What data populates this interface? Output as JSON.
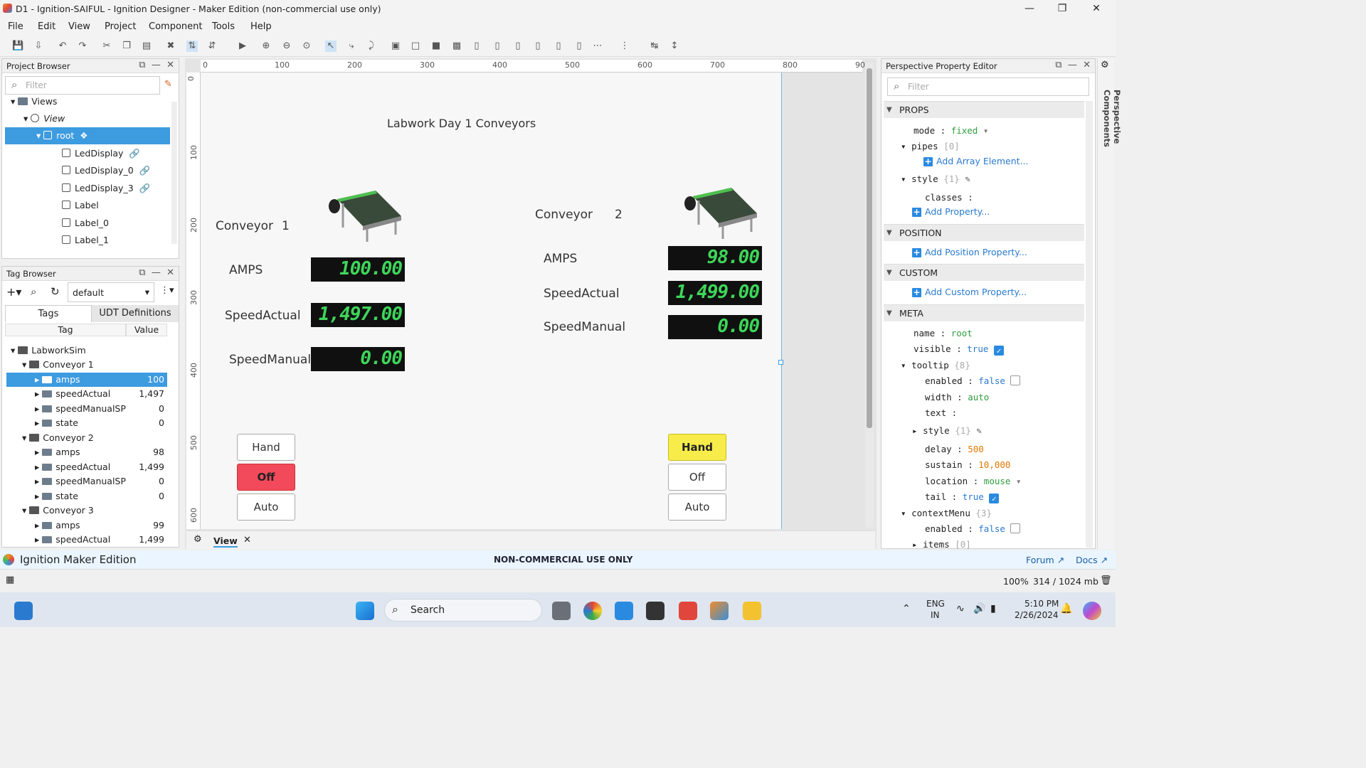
{
  "window": {
    "title": "D1 - Ignition-SAIFUL - Ignition Designer - Maker Edition (non-commercial use only)"
  },
  "menu": [
    "File",
    "Edit",
    "View",
    "Project",
    "Component",
    "Tools",
    "Help"
  ],
  "project_browser": {
    "title": "Project Browser",
    "filter_placeholder": "Filter",
    "items": [
      {
        "label": "Views"
      },
      {
        "label": "View"
      },
      {
        "label": "root"
      },
      {
        "label": "LedDisplay"
      },
      {
        "label": "LedDisplay_0"
      },
      {
        "label": "LedDisplay_3"
      },
      {
        "label": "Label"
      },
      {
        "label": "Label_0"
      },
      {
        "label": "Label_1"
      }
    ]
  },
  "tag_browser": {
    "title": "Tag Browser",
    "provider": "default",
    "tabs": [
      "Tags",
      "UDT Definitions"
    ],
    "col_tag": "Tag",
    "col_value": "Value",
    "rows": [
      {
        "name": "LabworkSim",
        "value": ""
      },
      {
        "name": "Conveyor 1",
        "value": ""
      },
      {
        "name": "amps",
        "value": "100"
      },
      {
        "name": "speedActual",
        "value": "1,497"
      },
      {
        "name": "speedManualSP",
        "value": "0"
      },
      {
        "name": "state",
        "value": "0"
      },
      {
        "name": "Conveyor 2",
        "value": ""
      },
      {
        "name": "amps",
        "value": "98"
      },
      {
        "name": "speedActual",
        "value": "1,499"
      },
      {
        "name": "speedManualSP",
        "value": "0"
      },
      {
        "name": "state",
        "value": "0"
      },
      {
        "name": "Conveyor 3",
        "value": ""
      },
      {
        "name": "amps",
        "value": "99"
      },
      {
        "name": "speedActual",
        "value": "1,499"
      }
    ]
  },
  "ruler": {
    "h": [
      "0",
      "100",
      "200",
      "300",
      "400",
      "500",
      "600",
      "700",
      "800",
      "90"
    ],
    "v": [
      "0",
      "100",
      "200",
      "300",
      "400",
      "500",
      "600"
    ]
  },
  "view": {
    "title": "Labwork Day 1 Conveyors",
    "tab": "View",
    "c1": {
      "name": "Conveyor",
      "num": "1",
      "amps_label": "AMPS",
      "amps": "100.00",
      "sa_label": "SpeedActual",
      "sa": "1,497.00",
      "sm_label": "SpeedManual",
      "sm": "0.00",
      "hand": "Hand",
      "off": "Off",
      "auto": "Auto"
    },
    "c2": {
      "name": "Conveyor",
      "num": "2",
      "amps_label": "AMPS",
      "amps": "98.00",
      "sa_label": "SpeedActual",
      "sa": "1,499.00",
      "sm_label": "SpeedManual",
      "sm": "0.00",
      "hand": "Hand",
      "off": "Off",
      "auto": "Auto"
    },
    "colors": {
      "off_active": "#f24a5a",
      "hand_active": "#f7ec4a",
      "led_text": "#3ed65a"
    }
  },
  "prop_editor": {
    "title": "Perspective Property Editor",
    "filter_placeholder": "Filter",
    "side_tab": "Perspective Components",
    "sections": {
      "props": "PROPS",
      "position": "POSITION",
      "custom": "CUSTOM",
      "meta": "META"
    },
    "props": {
      "mode_k": "mode",
      "mode_v": "fixed",
      "pipes_k": "pipes",
      "pipes_c": "[0]",
      "add_array": "Add Array Element...",
      "style_k": "style",
      "style_c": "{1}",
      "classes_k": "classes",
      "add_prop": "Add Property..."
    },
    "add_position": "Add Position Property...",
    "add_custom": "Add Custom Property...",
    "meta": {
      "name_k": "name",
      "name_v": "root",
      "visible_k": "visible",
      "visible_v": "true",
      "tooltip_k": "tooltip",
      "tooltip_c": "{8}",
      "enabled_k": "enabled",
      "enabled_v": "false",
      "width_k": "width",
      "width_v": "auto",
      "text_k": "text",
      "style_k": "style",
      "style_c": "{1}",
      "delay_k": "delay",
      "delay_v": "500",
      "sustain_k": "sustain",
      "sustain_v": "10,000",
      "location_k": "location",
      "location_v": "mouse",
      "tail_k": "tail",
      "tail_v": "true",
      "ctx_k": "contextMenu",
      "ctx_c": "{3}",
      "ctx_enabled_k": "enabled",
      "ctx_enabled_v": "false",
      "items_k": "items",
      "items_c": "[0]"
    }
  },
  "status": {
    "brand": "Ignition Maker Edition",
    "center": "NON-COMMERCIAL USE ONLY",
    "forum": "Forum",
    "docs": "Docs",
    "zoom": "100%",
    "memory": "314 / 1024 mb"
  },
  "taskbar": {
    "search": "Search",
    "lang1": "ENG",
    "lang2": "IN",
    "time": "5:10 PM",
    "date": "2/26/2024"
  }
}
